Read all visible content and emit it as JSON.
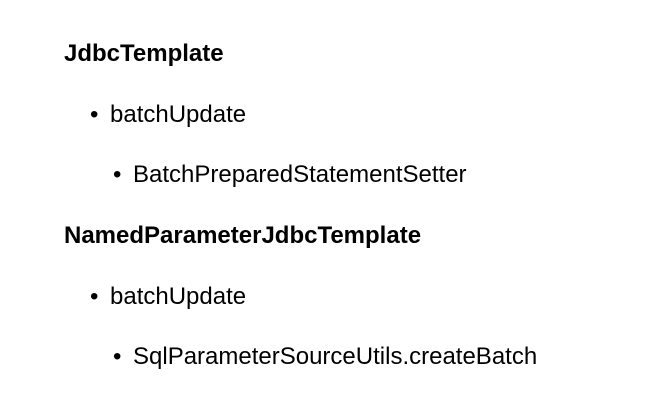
{
  "sections": [
    {
      "title": "JdbcTemplate",
      "method": "batchUpdate",
      "helper": "BatchPreparedStatementSetter"
    },
    {
      "title": "NamedParameterJdbcTemplate",
      "method": "batchUpdate",
      "helper": "SqlParameterSourceUtils.createBatch"
    }
  ]
}
